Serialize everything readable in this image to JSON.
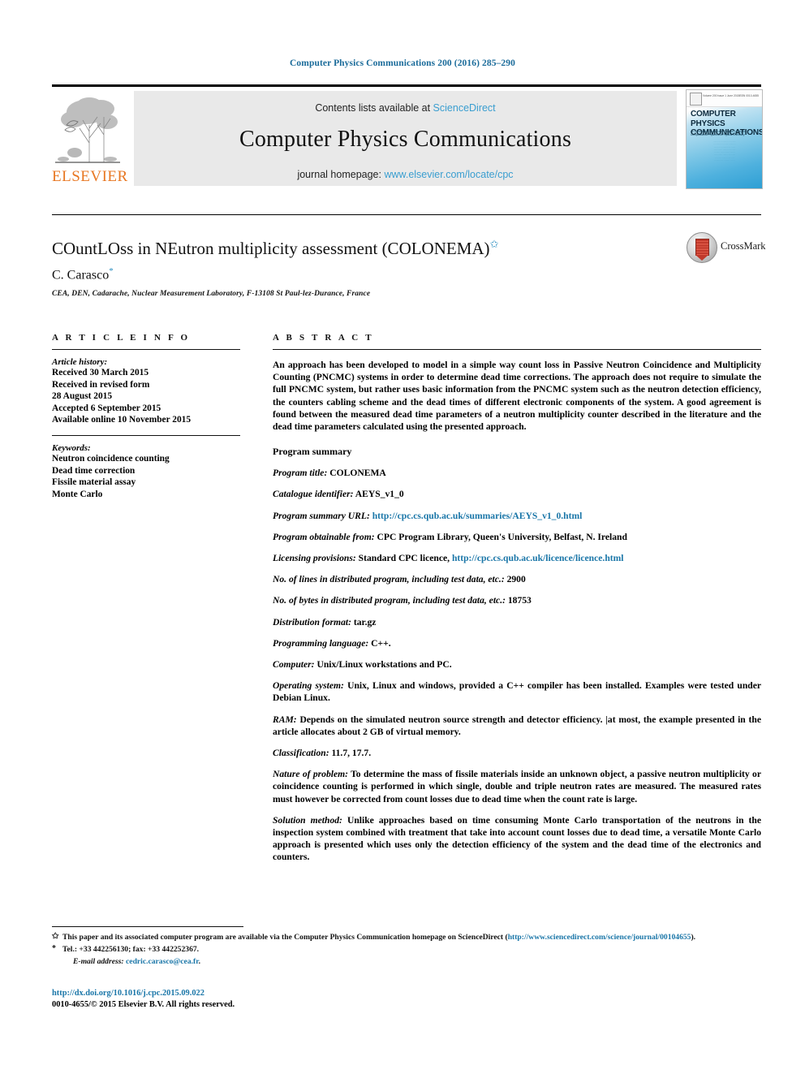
{
  "running_head": "Computer Physics Communications 200 (2016) 285–290",
  "masthead": {
    "contents_prefix": "Contents lists available at ",
    "sciencedirect": "ScienceDirect",
    "journal_title": "Computer Physics Communications",
    "homepage_prefix": "journal homepage: ",
    "homepage_url": "www.elsevier.com/locate/cpc",
    "publisher": "ELSEVIER",
    "cover": {
      "title_line1": "COMPUTER PHYSICS",
      "title_line2": "COMMUNICATIONS",
      "subtitle": "An International Journal and Program Library for Computational Physics and Physical Chemistry",
      "corner_left": "Volume 200 Issue 1 June 2015",
      "corner_right": "ISSN 0010-4655"
    }
  },
  "article": {
    "title": "COuntLOss in NEutron multiplicity assessment (COLONEMA)",
    "title_footnote_mark": "✩",
    "author": "C. Carasco",
    "author_footnote_mark": "*",
    "affiliation": "CEA, DEN, Cadarache, Nuclear Measurement Laboratory, F-13108 St Paul-lez-Durance, France"
  },
  "crossmark": {
    "label": "CrossMark"
  },
  "article_info": {
    "heading": "A R T I C L E   I N F O",
    "history_label": "Article history:",
    "history": [
      "Received 30 March 2015",
      "Received in revised form",
      "28 August 2015",
      "Accepted 6 September 2015",
      "Available online 10 November 2015"
    ],
    "keywords_label": "Keywords:",
    "keywords": [
      "Neutron coincidence counting",
      "Dead time correction",
      "Fissile material assay",
      "Monte Carlo"
    ]
  },
  "abstract": {
    "heading": "A B S T R A C T",
    "text": "An approach has been developed to model in a simple way count loss in Passive Neutron Coincidence and Multiplicity Counting (PNCMC) systems in order to determine dead time corrections. The approach does not require to simulate the full PNCMC system, but rather uses basic information from the PNCMC system such as the neutron detection efficiency, the counters cabling scheme and the dead times of different electronic components of the system. A good agreement is found between the measured dead time parameters of a neutron multiplicity counter described in the literature and the dead time parameters calculated using the presented approach."
  },
  "program_summary": {
    "heading": "Program summary",
    "items": [
      {
        "label": "Program title:",
        "value": " COLONEMA"
      },
      {
        "label": "Catalogue identifier:",
        "value": " AEYS_v1_0"
      },
      {
        "label": "Program summary URL:",
        "value": "",
        "link": "http://cpc.cs.qub.ac.uk/summaries/AEYS_v1_0.html"
      },
      {
        "label": "Program obtainable from:",
        "value": " CPC Program Library, Queen's University, Belfast, N. Ireland"
      },
      {
        "label": "Licensing provisions:",
        "value": " Standard CPC licence, ",
        "link": "http://cpc.cs.qub.ac.uk/licence/licence.html"
      },
      {
        "label": "No. of lines in distributed program, including test data, etc.:",
        "value": " 2900"
      },
      {
        "label": "No. of bytes in distributed program, including test data, etc.:",
        "value": " 18753"
      },
      {
        "label": "Distribution format:",
        "value": " tar.gz"
      },
      {
        "label": "Programming language:",
        "value": " C++."
      },
      {
        "label": "Computer:",
        "value": " Unix/Linux workstations and PC."
      },
      {
        "label": "Operating system:",
        "value": " Unix, Linux and windows, provided a C++ compiler has been installed. Examples were tested under Debian Linux."
      },
      {
        "label": "RAM:",
        "value": " Depends on the simulated neutron source strength and detector efficiency. |at most, the example presented in the article allocates about 2 GB of virtual memory."
      },
      {
        "label": "Classification:",
        "value": " 11.7, 17.7."
      },
      {
        "label": "Nature of problem:",
        "value": " To determine the mass of fissile materials inside an unknown object, a passive neutron multiplicity or coincidence counting is performed in which single, double and triple neutron rates are measured. The measured rates must however be corrected from count losses due to dead time when the count rate is large."
      },
      {
        "label": "Solution method:",
        "value": " Unlike approaches based on time consuming Monte Carlo transportation of the neutrons in the inspection system combined with treatment that take into account count losses due to dead time, a versatile Monte Carlo approach is presented which uses only the detection efficiency of the system and the dead time of the electronics and counters."
      }
    ]
  },
  "footnotes": {
    "star_mark": "✩",
    "star_text_a": "This paper and its associated computer program are available via the Computer Physics Communication homepage on ScienceDirect  (",
    "star_link": "http://www.sciencedirect.com/science/journal/00104655",
    "star_text_b": ").",
    "corr_mark": "*",
    "corr_text": "Tel.: +33 442256130; fax: +33 442252367.",
    "email_label": "E-mail address:",
    "email": "cedric.carasco@cea.fr",
    "email_trail": ".",
    "doi": "http://dx.doi.org/10.1016/j.cpc.2015.09.022",
    "copyright": "0010-4655/© 2015 Elsevier B.V. All rights reserved."
  },
  "colors": {
    "link": "#1a76a8",
    "sciencedirect": "#3a9ed0",
    "running_head": "#1a6b9a",
    "elsevier_orange": "#e87722",
    "crossmark_red": "#c0392b"
  }
}
